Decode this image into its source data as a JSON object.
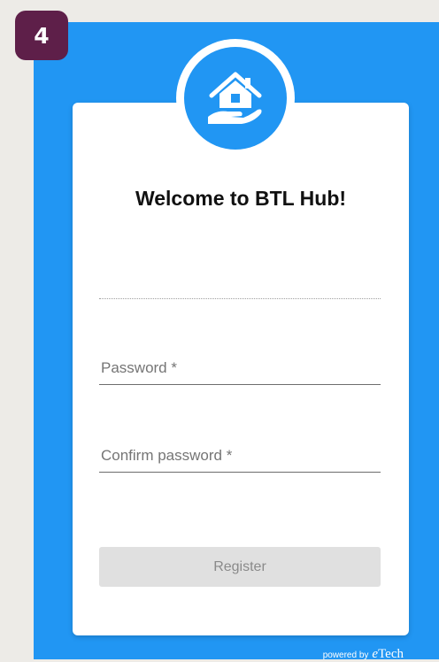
{
  "badge": {
    "step": "4"
  },
  "card": {
    "title": "Welcome to BTL Hub!",
    "password": {
      "placeholder": "Password *",
      "value": ""
    },
    "confirm_password": {
      "placeholder": "Confirm password *",
      "value": ""
    },
    "register_label": "Register"
  },
  "footer": {
    "powered_label": "powered by",
    "brand_prefix": "e",
    "brand_suffix": "Tech"
  },
  "icons": {
    "logo": "house-in-hand-icon"
  },
  "colors": {
    "background": "#edebe7",
    "panel_blue": "#2196f3",
    "badge": "#5e1f49",
    "button_disabled": "#e0e0e0"
  }
}
